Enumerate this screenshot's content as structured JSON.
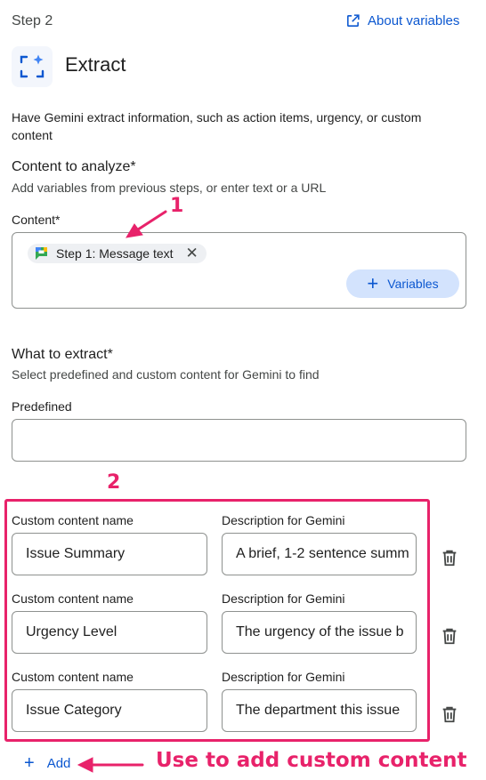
{
  "header": {
    "step_label": "Step 2",
    "about_link": "About variables",
    "title": "Extract",
    "description": "Have Gemini extract information, such as action items, urgency, or custom content"
  },
  "content_section": {
    "heading": "Content to analyze*",
    "subtext": "Add variables from previous steps, or enter text or a URL",
    "field_label": "Content*",
    "chip_label": "Step 1: Message text",
    "chip_remove": "✕",
    "variables_button": "Variables"
  },
  "extract_section": {
    "heading": "What to extract*",
    "subtext": "Select predefined and custom content for Gemini to find",
    "predefined_label": "Predefined",
    "predefined_value": ""
  },
  "custom_rows": [
    {
      "name_label": "Custom content name",
      "desc_label": "Description for Gemini",
      "name_value": "Issue Summary",
      "desc_value": "A brief, 1-2 sentence summ"
    },
    {
      "name_label": "Custom content name",
      "desc_label": "Description for Gemini",
      "name_value": "Urgency Level",
      "desc_value": "The urgency of the issue b"
    },
    {
      "name_label": "Custom content name",
      "desc_label": "Description for Gemini",
      "name_value": "Issue Category",
      "desc_value": "The department this issue"
    }
  ],
  "add_button": "Add",
  "annotations": {
    "marker_1": "1",
    "marker_2": "2",
    "callout": "Use to add custom content"
  },
  "colors": {
    "accent": "#0b57d0",
    "annotation": "#e8226a",
    "chip_bg": "#eef0f3",
    "button_bg": "#d3e3fd"
  },
  "icons": {
    "about": "open-in-new-icon",
    "extract": "extract-sparkle-icon",
    "chip": "google-chat-icon",
    "delete": "trash-icon",
    "add": "plus-icon"
  }
}
